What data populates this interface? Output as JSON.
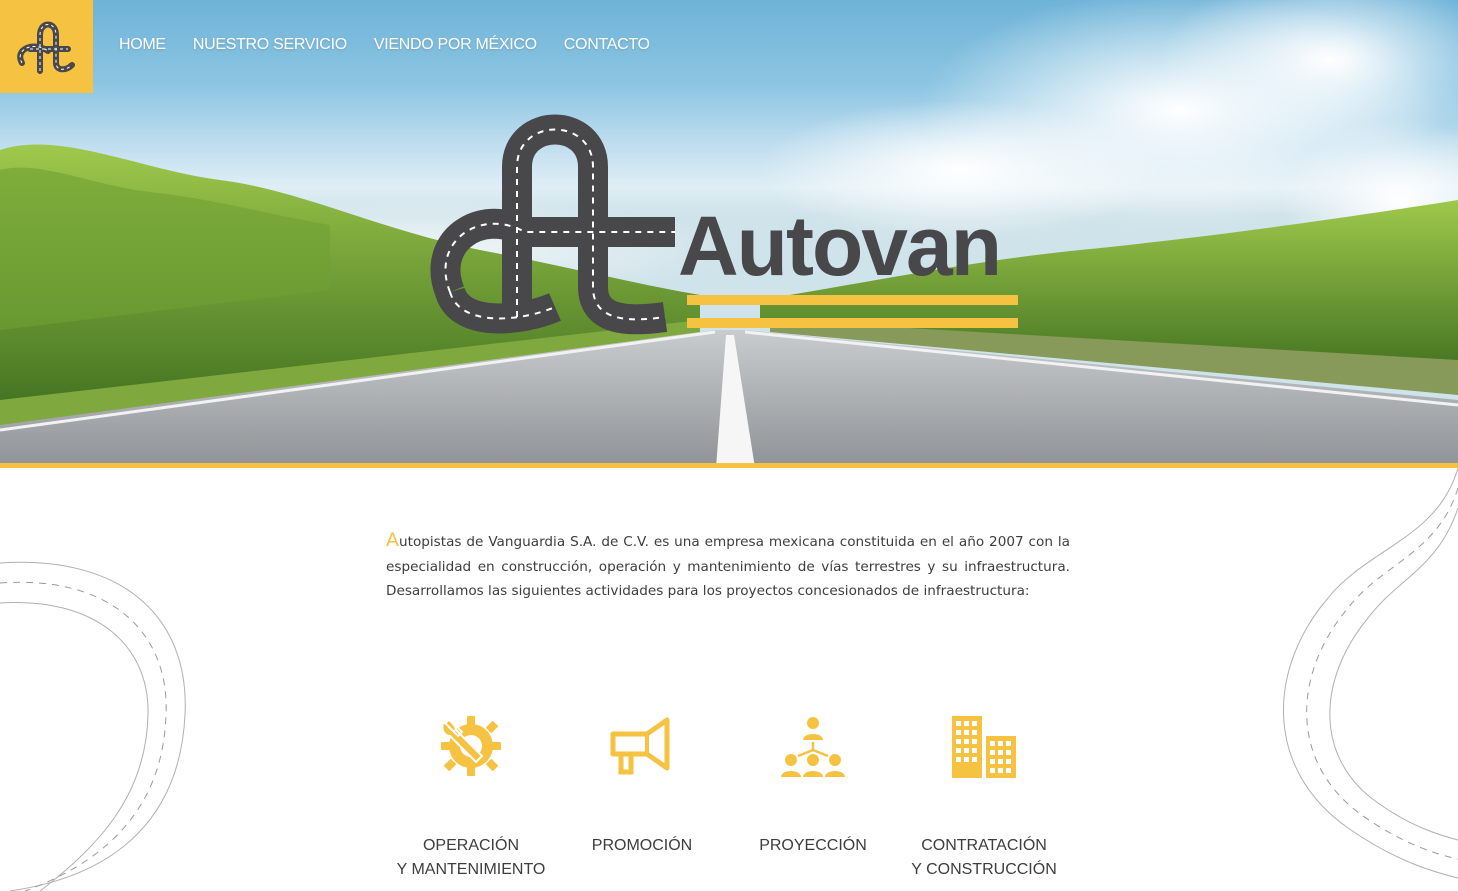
{
  "header": {
    "logo_letter": "A",
    "nav": [
      {
        "label": "HOME"
      },
      {
        "label": "NUESTRO SERVICIO"
      },
      {
        "label": "VIENDO POR MÉXICO"
      },
      {
        "label": "CONTACTO"
      }
    ]
  },
  "hero": {
    "brand_name": "Autovan"
  },
  "intro": {
    "first_letter": "A",
    "text": "utopistas de Vanguardia S.A. de C.V. es una empresa mexicana constituida en el año 2007 con la especialidad en construcción, operación y mantenimiento de vías terrestres y su infraestructura. Desarrollamos las siguientes actividades para los proyectos concesionados de infraestructura:"
  },
  "services": [
    {
      "line1": "OPERACIÓN",
      "line2": "Y MANTENIMIENTO",
      "icon": "gear-wrench-icon"
    },
    {
      "line1": "PROMOCIÓN",
      "line2": "",
      "icon": "megaphone-icon"
    },
    {
      "line1": "PROYECCIÓN",
      "line2": "",
      "icon": "team-network-icon"
    },
    {
      "line1": "CONTRATACIÓN",
      "line2": "Y CONSTRUCCIÓN",
      "icon": "buildings-icon"
    }
  ],
  "colors": {
    "accent": "#f5c242",
    "logo_gray": "#48484a",
    "text": "#3d3d3d"
  }
}
